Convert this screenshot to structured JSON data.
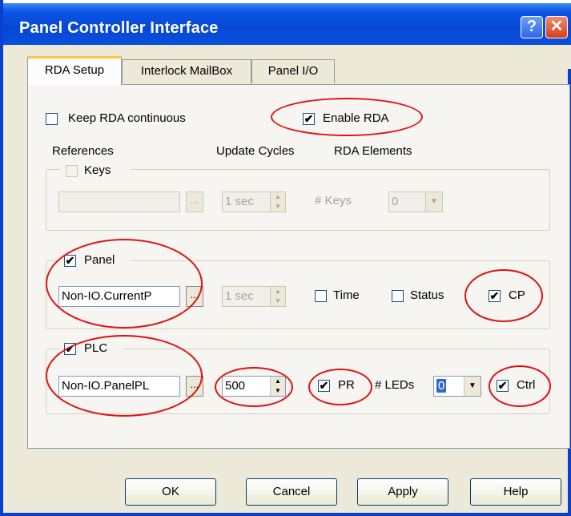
{
  "window": {
    "title": "Panel Controller Interface",
    "help_glyph": "?",
    "close_glyph": "✕"
  },
  "tabs": [
    {
      "label": "RDA Setup",
      "active": true
    },
    {
      "label": "Interlock MailBox",
      "active": false
    },
    {
      "label": "Panel I/O",
      "active": false
    }
  ],
  "top": {
    "keep_rda_label": "Keep RDA continuous",
    "keep_rda_checked": false,
    "enable_rda_label": "Enable RDA",
    "enable_rda_checked": true
  },
  "headers": {
    "references": "References",
    "update_cycles": "Update Cycles",
    "rda_elements": "RDA Elements"
  },
  "keys": {
    "label": "Keys",
    "checked": false,
    "ref_value": "",
    "browse": "...",
    "cycle": "1 sec",
    "count_label": "# Keys",
    "count_value": "0"
  },
  "panel": {
    "label": "Panel",
    "checked": true,
    "ref_value": "Non-IO.CurrentP",
    "browse": "...",
    "cycle": "1 sec",
    "time_label": "Time",
    "time_checked": false,
    "status_label": "Status",
    "status_checked": false,
    "cp_label": "CP",
    "cp_checked": true
  },
  "plc": {
    "label": "PLC",
    "checked": true,
    "ref_value": "Non-IO.PanelPL",
    "browse": "...",
    "cycle": "500",
    "pr_label": "PR",
    "pr_checked": true,
    "leds_label": "# LEDs",
    "leds_value": "0",
    "ctrl_label": "Ctrl",
    "ctrl_checked": true
  },
  "buttons": {
    "ok": "OK",
    "cancel": "Cancel",
    "apply": "Apply",
    "help": "Help"
  },
  "check_glyph": "✔",
  "colors": {
    "title_bar": "#0a4fdd",
    "annotation": "#e01010",
    "face": "#ece9d8"
  }
}
